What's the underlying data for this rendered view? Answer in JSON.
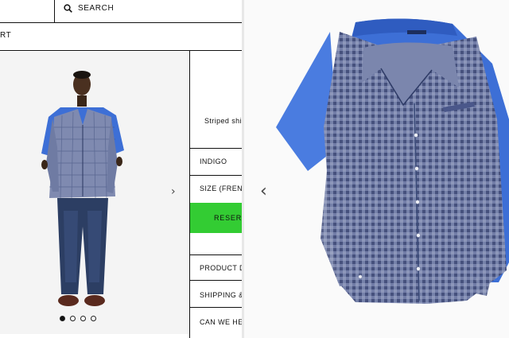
{
  "header": {
    "search_label": "SEARCH",
    "breadcrumb": "RT"
  },
  "icons": {
    "search": "search-icon",
    "next": "chevron-right-icon",
    "prev": "chevron-left-icon"
  },
  "carousel": {
    "dots": [
      true,
      false,
      false,
      false
    ]
  },
  "product": {
    "name": "Striped shi",
    "color": "INDIGO",
    "size": "SIZE (FRENC",
    "reserve_label": "RESER",
    "sections": [
      "PRODUCT D",
      "SHIPPING &",
      "CAN WE HE"
    ]
  },
  "colors": {
    "accent": "#33cc33",
    "shirt_blue": "#3d6fd6",
    "check_navy": "#3a4a78"
  }
}
